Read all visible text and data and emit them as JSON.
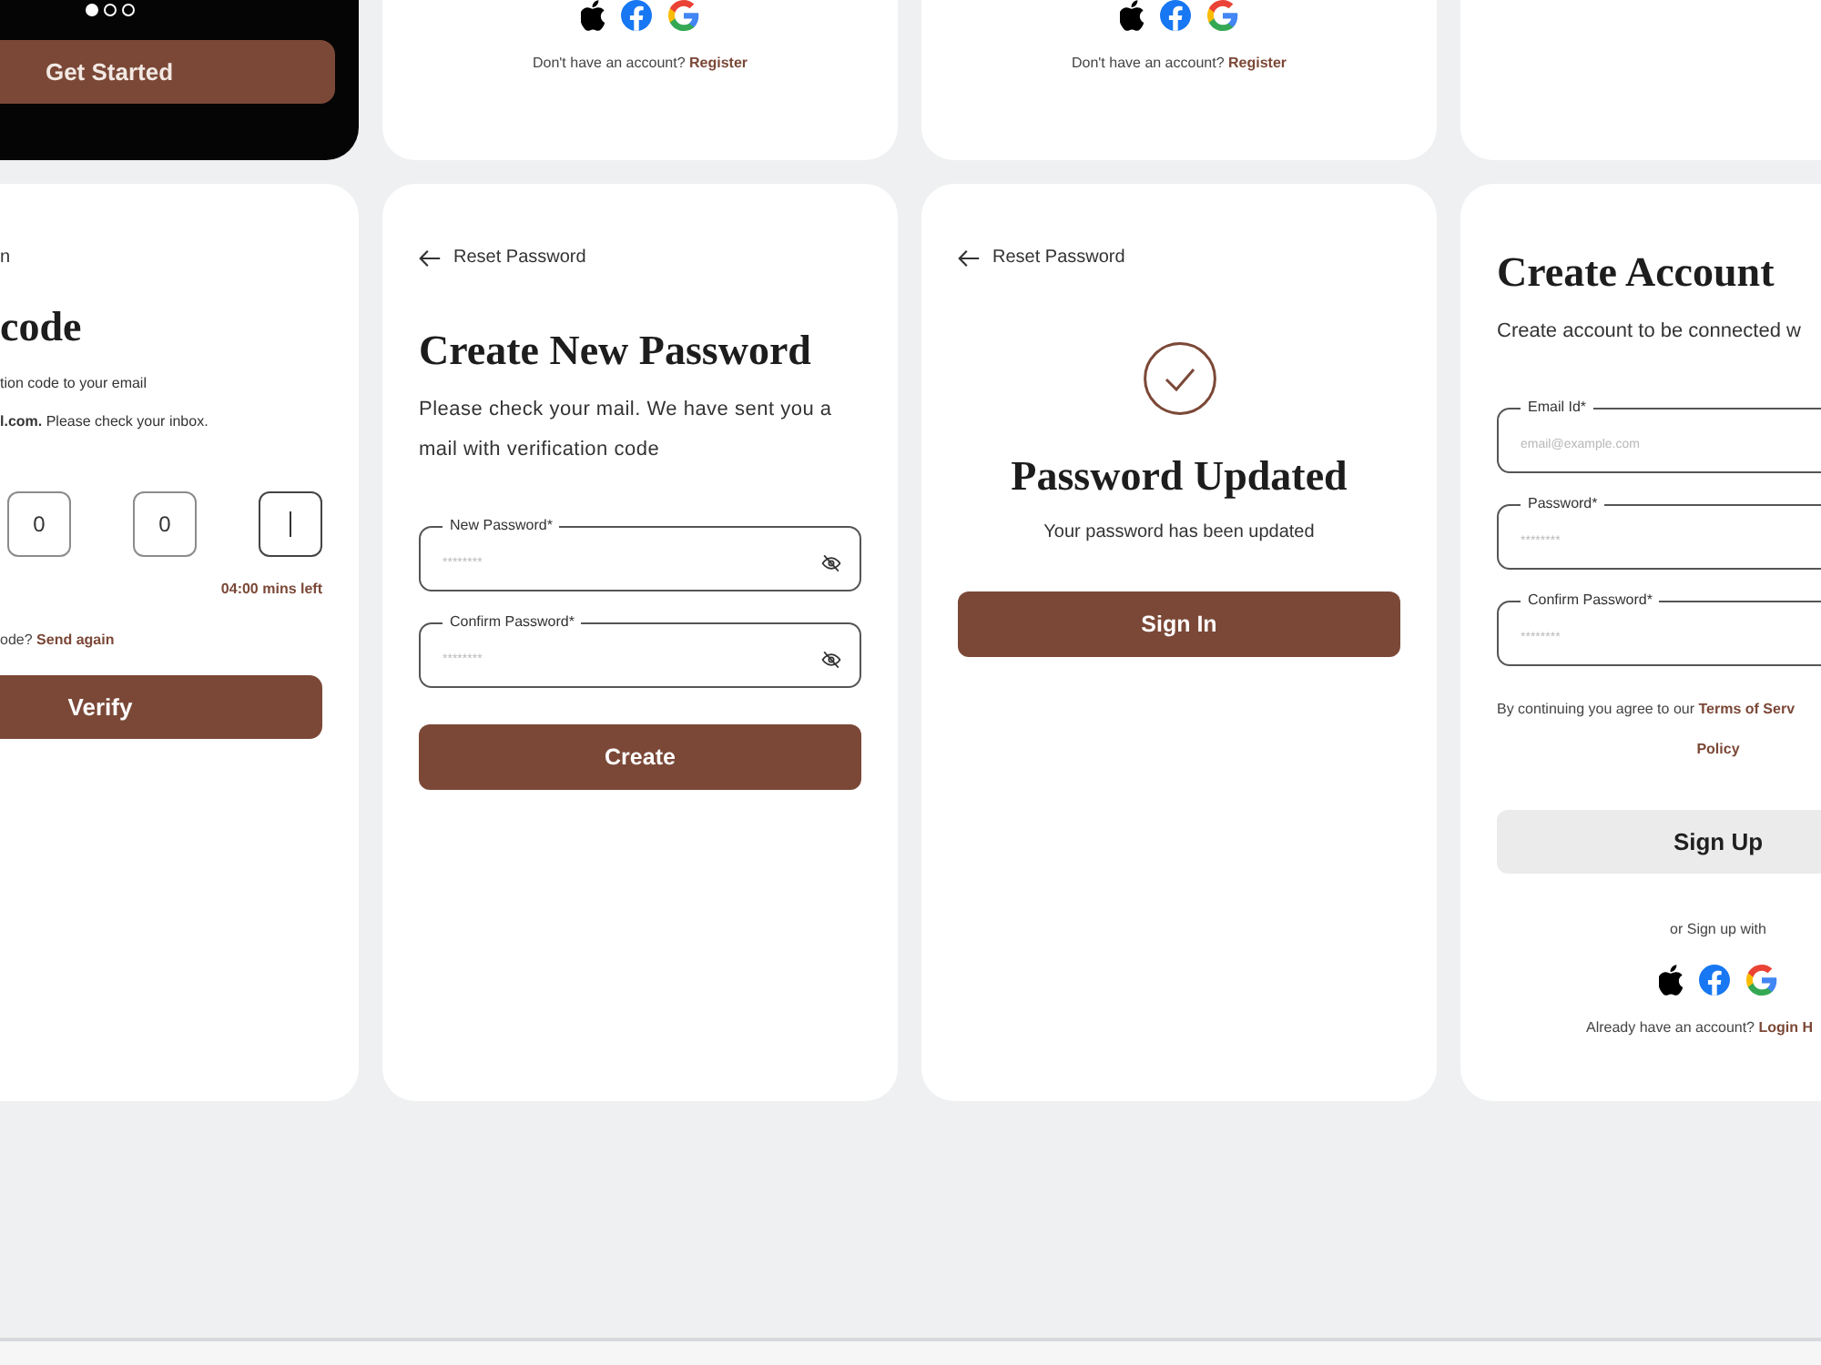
{
  "onboarding": {
    "pages": [
      {
        "selected": true
      },
      {
        "selected": false
      },
      {
        "selected": false
      }
    ],
    "button": {
      "label": "Get Started",
      "disabled": false
    }
  },
  "login_screens": [
    {
      "prompt": "Don't have an account?",
      "link": "Register"
    },
    {
      "prompt": "Don't have an account?",
      "link": "Register"
    }
  ],
  "verification": {
    "back": "n",
    "title": "code",
    "lines": [
      "tion code to your email",
      "**l.com.** Please check your inbox."
    ],
    "otp": [
      {
        "value": "0",
        "focused": false
      },
      {
        "value": "0",
        "focused": false
      },
      {
        "focused": true
      }
    ],
    "timer": "04:00 mins left",
    "resend_prompt": "ode?",
    "resend_link": "Send again",
    "button": {
      "label": "Verify",
      "disabled": false
    }
  },
  "new_password": {
    "back": "Reset Password",
    "title": "Create New Password",
    "text": "Please check your mail. We have sent you a mail with verification code",
    "fields": [
      {
        "label": "New Password*",
        "placeholder": "********",
        "visibility_toggle": true
      },
      {
        "label": "Confirm Password*",
        "placeholder": "********",
        "visibility_toggle": true
      }
    ],
    "button": {
      "label": "Create",
      "disabled": false
    }
  },
  "password_updated": {
    "back": "Reset Password",
    "title": "Password Updated",
    "text": "Your password has been updated",
    "button": {
      "label": "Sign In",
      "disabled": false
    }
  },
  "create_account": {
    "title": "Create Account",
    "subtitle": "Create account to be connected w",
    "fields": [
      {
        "label": "Email Id*",
        "placeholder": "email@example.com"
      },
      {
        "label": "Password*",
        "placeholder": "********"
      },
      {
        "label": "Confirm Password*",
        "placeholder": "********"
      }
    ],
    "terms_text": "By continuing you agree to our",
    "terms_link": "Terms of Serv",
    "policy_link": "Policy",
    "button": {
      "label": "Sign Up",
      "disabled": true
    },
    "alt_text": "or Sign up with",
    "login_prompt": "Already have an account?",
    "login_link": "Login H"
  }
}
